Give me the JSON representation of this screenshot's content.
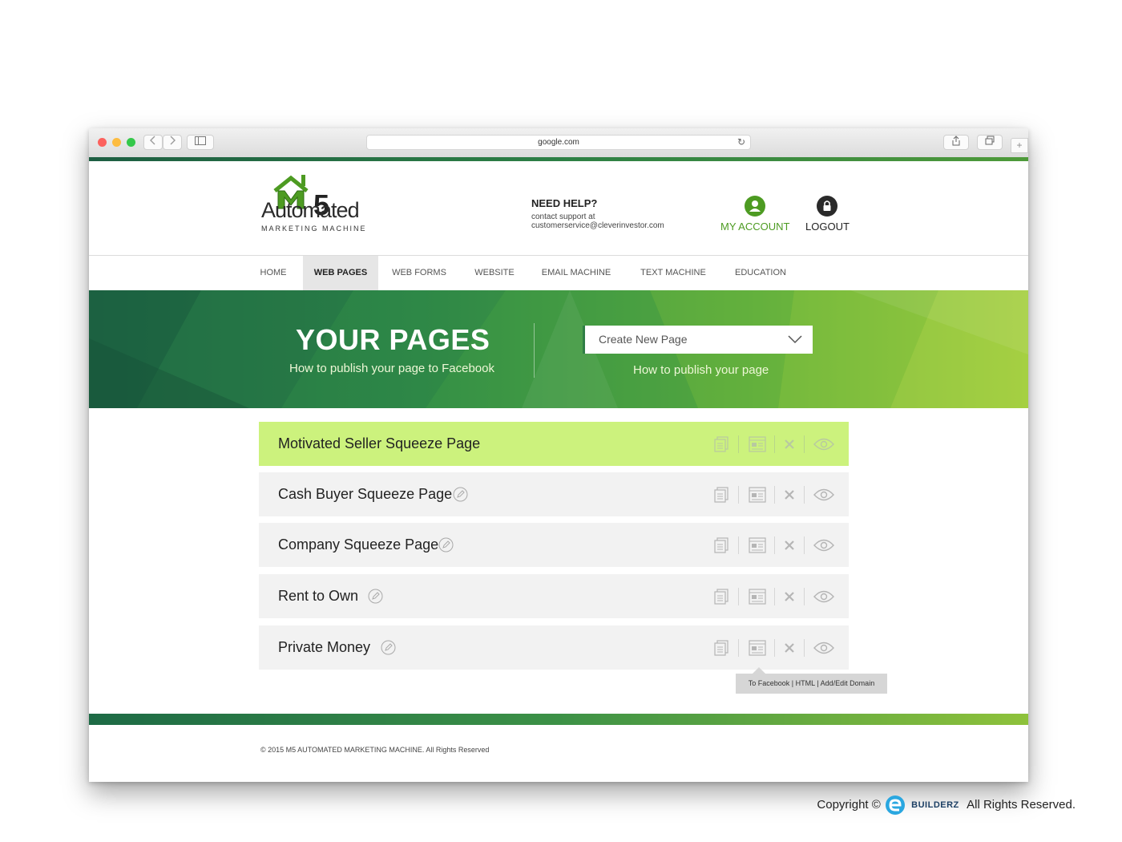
{
  "browser": {
    "url": "google.com",
    "traffic_lights": [
      "#fc615d",
      "#fdbc40",
      "#34c84a"
    ]
  },
  "header": {
    "logo": {
      "number": "5",
      "word": "Automated",
      "tagline": "MARKETING MACHINE",
      "icon": "house-m-logo-icon"
    },
    "help_title": "NEED HELP?",
    "help_line1": "contact support at",
    "help_email": "customerservice@cleverinvestor.com",
    "my_account": "MY ACCOUNT",
    "logout": "LOGOUT"
  },
  "nav": {
    "items": [
      {
        "label": "HOME"
      },
      {
        "label": "WEB PAGES",
        "active": true
      },
      {
        "label": "WEB FORMS"
      },
      {
        "label": "WEBSITE"
      },
      {
        "label": "EMAIL MACHINE"
      },
      {
        "label": "TEXT MACHINE"
      },
      {
        "label": "EDUCATION"
      }
    ]
  },
  "hero": {
    "title": "YOUR PAGES",
    "facebook_link": "How to publish your page to Facebook",
    "select_placeholder": "Create New Page",
    "publish_link": "How to publish your page"
  },
  "pages": [
    {
      "title": "Motivated Seller Squeeze Page",
      "highlighted": true,
      "editable": false
    },
    {
      "title": "Cash Buyer Squeeze Page",
      "editable": true
    },
    {
      "title": "Company Squeeze Page",
      "editable": true
    },
    {
      "title": "Rent to Own",
      "editable": true
    },
    {
      "title": "Private Money",
      "editable": true
    }
  ],
  "row_actions": [
    "copy-icon",
    "publish-icon",
    "delete-icon",
    "preview-icon"
  ],
  "tooltip": "To Facebook | HTML | Add/Edit Domain",
  "footer": {
    "copyright": "© 2015 M5 AUTOMATED MARKETING MACHINE. All Rights Reserved"
  },
  "watermark": {
    "prefix": "Copyright ©",
    "brand": "BUILDERZ",
    "suffix": "All Rights Reserved."
  },
  "colors": {
    "brand_green": "#4d9b22",
    "dark_green": "#2f7e45",
    "highlight_row": "#ccf27d",
    "row_bg": "#f2f2f2"
  }
}
